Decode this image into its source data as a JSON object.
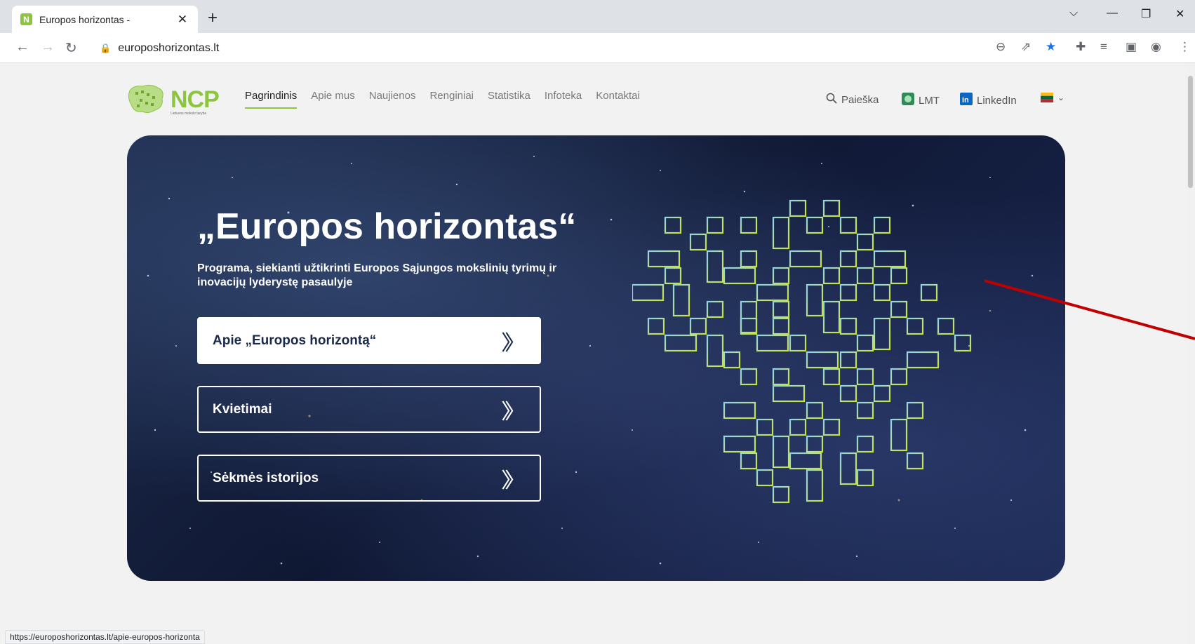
{
  "browser": {
    "tab_title": "Europos horizontas -",
    "favicon_letter": "N",
    "url": "europoshorizontas.lt",
    "status_url": "https://europoshorizontas.lt/apie-europos-horizonta"
  },
  "header": {
    "logo_text": "NCP",
    "logo_subtitle": "Lietuvos mokslo taryba",
    "nav": [
      {
        "label": "Pagrindinis",
        "active": true
      },
      {
        "label": "Apie mus"
      },
      {
        "label": "Naujienos"
      },
      {
        "label": "Renginiai"
      },
      {
        "label": "Statistika"
      },
      {
        "label": "Infoteka"
      },
      {
        "label": "Kontaktai"
      }
    ],
    "search_label": "Paieška",
    "lmt_label": "LMT",
    "linkedin_label": "LinkedIn"
  },
  "hero": {
    "title": "„Europos horizontas“",
    "subtitle": "Programa, siekianti užtikrinti Europos Sąjungos mokslinių tyrimų ir inovacijų lyderystę pasaulyje",
    "buttons": [
      {
        "label": "Apie „Europos horizontą“",
        "style": "primary"
      },
      {
        "label": "Kvietimai",
        "style": "secondary"
      },
      {
        "label": "Sėkmės istorijos",
        "style": "secondary"
      }
    ]
  },
  "colors": {
    "accent": "#8cc63f",
    "hero_bg": "#0f1833",
    "annotation_arrow": "#c00000"
  }
}
